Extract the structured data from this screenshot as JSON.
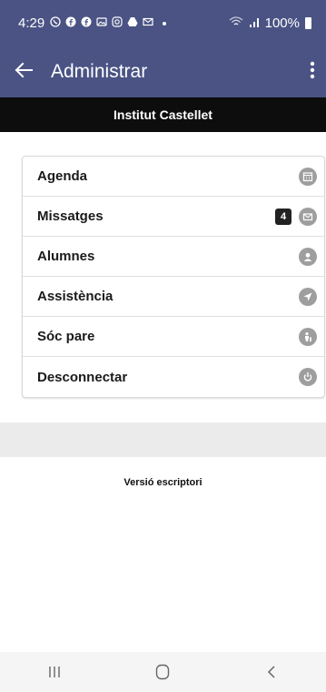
{
  "status_bar": {
    "time": "4:29",
    "battery": "100%",
    "notification_icons": [
      "whatsapp-icon",
      "facebook-icon",
      "facebook-icon",
      "gallery-icon",
      "instagram-icon",
      "drive-icon",
      "gmail-icon",
      "dot-icon"
    ]
  },
  "app_bar": {
    "title": "Administrar"
  },
  "school_name": "Institut Castellet",
  "menu": {
    "items": [
      {
        "label": "Agenda",
        "icon": "calendar-icon"
      },
      {
        "label": "Missatges",
        "icon": "mail-icon",
        "badge": "4"
      },
      {
        "label": "Alumnes",
        "icon": "user-icon"
      },
      {
        "label": "Assistència",
        "icon": "location-arrow-icon"
      },
      {
        "label": "Sóc pare",
        "icon": "parent-icon"
      },
      {
        "label": "Desconnectar",
        "icon": "power-icon"
      }
    ]
  },
  "footer": {
    "desktop_version": "Versió escriptori"
  },
  "colors": {
    "primary": "#4a5384",
    "school_bar": "#0d0d0d",
    "icon_gray": "#9e9e9e"
  }
}
